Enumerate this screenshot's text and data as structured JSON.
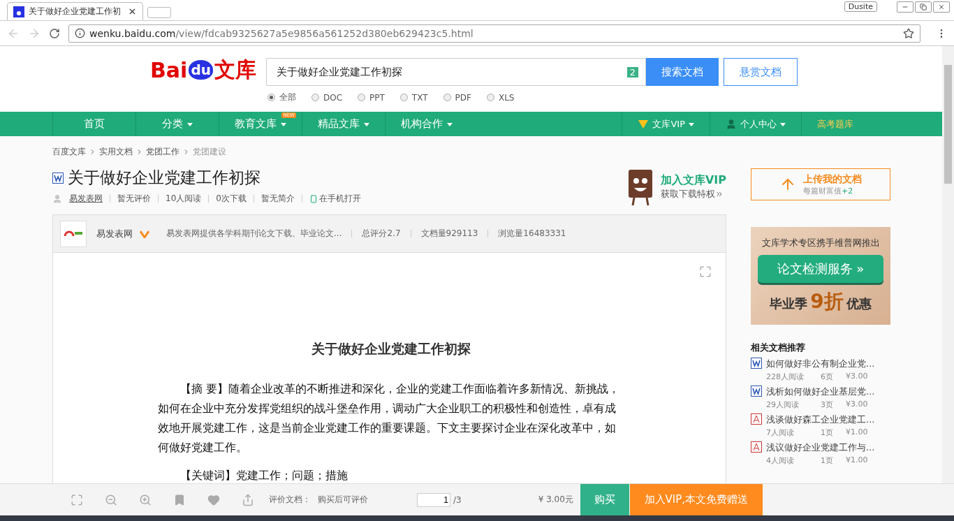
{
  "browser": {
    "tab_title": "关于做好企业党建工作初",
    "profile": "Dusite",
    "url_domain": "wenku.baidu.com",
    "url_path": "/view/fdcab9325627a5e9856a561252d380eb629423c5.html"
  },
  "header": {
    "logo_text": "Bai",
    "logo_du": "du",
    "logo_suffix": "文库",
    "search_value": "关于做好企业党建工作初探",
    "search_count": "2",
    "search_button": "搜索文档",
    "reward_button": "悬赏文档",
    "filters": [
      {
        "label": "全部",
        "selected": true
      },
      {
        "label": "DOC",
        "selected": false
      },
      {
        "label": "PPT",
        "selected": false
      },
      {
        "label": "TXT",
        "selected": false
      },
      {
        "label": "PDF",
        "selected": false
      },
      {
        "label": "XLS",
        "selected": false
      }
    ]
  },
  "nav": {
    "items": [
      {
        "label": "首页",
        "dropdown": false
      },
      {
        "label": "分类",
        "dropdown": true
      },
      {
        "label": "教育文库",
        "dropdown": true,
        "badge": "NEW"
      },
      {
        "label": "精品文库",
        "dropdown": true
      },
      {
        "label": "机构合作",
        "dropdown": true
      }
    ],
    "right_items": [
      {
        "kind": "vip",
        "label": "文库VIP"
      },
      {
        "kind": "user",
        "label": "个人中心"
      },
      {
        "kind": "link",
        "label": "高考题库"
      }
    ]
  },
  "breadcrumb": [
    "百度文库",
    "实用文档",
    "党团工作",
    "党团建设"
  ],
  "doc": {
    "title": "关于做好企业党建工作初探",
    "author": "易发表网",
    "meta": [
      "暂无评价",
      "10人阅读",
      "0次下载",
      "暂无简介"
    ],
    "mobile": "在手机打开",
    "vip_title": "加入文库VIP",
    "vip_subtitle": "获取下载特权"
  },
  "uploader": {
    "name": "易发表网",
    "description": "易发表网提供各学科期刊论文下载、毕业论文...",
    "stats": [
      "总评分2.7",
      "文档量929113",
      "浏览量16483331"
    ]
  },
  "document": {
    "title": "关于做好企业党建工作初探",
    "paragraphs": [
      "【摘  要】随着企业改革的不断推进和深化，企业的党建工作面临着许多新情况、新挑战，如何在企业中充分发挥党组织的战斗堡垒作用，调动广大企业职工的积极性和创造性，卓有成效地开展党建工作，这是当前企业党建工作的重要课题。下文主要探讨企业在深化改革中，如何做好党建工作。",
      "【关键词】党建工作；问题；措施"
    ]
  },
  "sidebar": {
    "upload_title": "上传我的文档",
    "upload_subtitle": "每篇财富值",
    "upload_bonus": "+2",
    "ad_line": "文库学术专区携手维普网推出",
    "ad_button": "论文检测服务 »",
    "ad_prefix": "毕业季",
    "ad_highlight": "9折",
    "ad_suffix": "优惠",
    "related_title": "相关文档推荐",
    "related": [
      {
        "kind": "word",
        "title": "如何做好非公有制企业党...",
        "reads": "228人阅读",
        "pages": "6页",
        "price": "¥3.00"
      },
      {
        "kind": "word",
        "title": "浅析如何做好企业基层党...",
        "reads": "29人阅读",
        "pages": "3页",
        "price": "¥3.00"
      },
      {
        "kind": "pdf",
        "title": "浅谈做好森工企业党建工...",
        "reads": "7人阅读",
        "pages": "1页",
        "price": "¥1.00"
      },
      {
        "kind": "pdf",
        "title": "浅议做好企业党建工作与...",
        "reads": "4人阅读",
        "pages": "1页",
        "price": "¥1.00"
      }
    ]
  },
  "bottom_bar": {
    "rating_label": "评价文档：",
    "rating_value": "购买后可评价",
    "page_current": "1",
    "page_total": "/3",
    "price": "¥ 3.00元",
    "buy_button": "购买",
    "vip_button": "加入VIP,本文免费赠送"
  }
}
